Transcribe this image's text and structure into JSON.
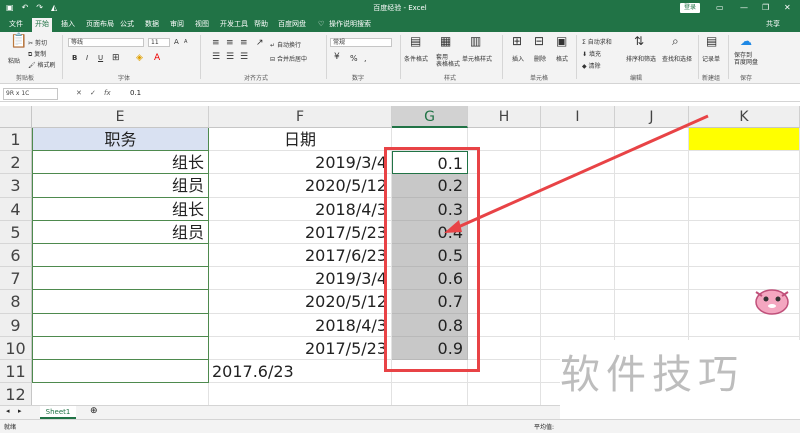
{
  "titlebar": {
    "title": "百度经验 - Excel",
    "login": "登录",
    "qat_icons": [
      "save-icon",
      "undo-icon",
      "redo-icon",
      "fill-color-icon"
    ],
    "controls": [
      "▭",
      "—",
      "❐",
      "✕"
    ]
  },
  "ribbon_tabs": [
    "文件",
    "开始",
    "插入",
    "页面布局",
    "公式",
    "数据",
    "审阅",
    "视图",
    "开发工具",
    "帮助",
    "百度网盘",
    "操作说明搜索"
  ],
  "active_tab": "开始",
  "share_label": "共享",
  "ribbon": {
    "clipboard": {
      "paste": "粘贴",
      "cut": "剪切",
      "copy": "复制",
      "format_painter": "格式刷",
      "group": "剪贴板"
    },
    "font": {
      "name": "等线",
      "size": "11",
      "bold": "B",
      "italic": "I",
      "underline": "U",
      "grow": "A",
      "shrink": "A",
      "group": "字体",
      "font_color": "#ff0000",
      "fill_color": "#ffff00"
    },
    "alignment": {
      "wrap": "自动换行",
      "merge": "合并后居中",
      "group": "对齐方式"
    },
    "number": {
      "format": "常规",
      "percent": "%",
      "comma": ",",
      "group": "数字"
    },
    "styles": {
      "conditional": "条件格式",
      "table": "套用\n表格格式",
      "cell_styles": "单元格样式",
      "group": "样式"
    },
    "cells": {
      "insert": "插入",
      "delete": "删除",
      "format": "格式",
      "group": "单元格"
    },
    "editing": {
      "autosum": "自动求和",
      "fill": "填充",
      "clear": "清除",
      "sort": "排序和筛选",
      "find": "查找和选择",
      "group": "编辑"
    },
    "newgroup": {
      "record": "记录单",
      "group": "新建组"
    },
    "save": {
      "save_to": "保存到\n百度网盘",
      "group": "保存"
    }
  },
  "formula_bar": {
    "name_box": "9R x 1C",
    "fx": "fx",
    "formula": "0.1"
  },
  "columns": [
    "E",
    "F",
    "G",
    "H",
    "I",
    "J",
    "K"
  ],
  "selected_column": "G",
  "rows": [
    "1",
    "2",
    "3",
    "4",
    "5",
    "6",
    "7",
    "8",
    "9",
    "10",
    "11",
    "12"
  ],
  "cells": {
    "E1": "职务",
    "F1": "日期",
    "E": [
      "组长",
      "组员",
      "组长",
      "组员",
      "",
      "",
      "",
      "",
      ""
    ],
    "F": [
      "2019/3/4",
      "2020/5/12",
      "2018/4/3",
      "2017/5/23",
      "2017/6/23",
      "2019/3/4",
      "2020/5/12",
      "2018/4/3",
      "2017/5/23"
    ],
    "G": [
      "0.1",
      "0.2",
      "0.3",
      "0.4",
      "0.5",
      "0.6",
      "0.7",
      "0.8",
      "0.9"
    ],
    "E11_F11": "2017.6/23"
  },
  "sheet_tab": "Sheet1",
  "add_sheet": "⊕",
  "status": {
    "left": "就绪",
    "right": "平均值:"
  },
  "watermark": "软件技巧",
  "colors": {
    "excel_green": "#217346",
    "highlight_red": "#e84346",
    "yellow": "#ffff00"
  }
}
